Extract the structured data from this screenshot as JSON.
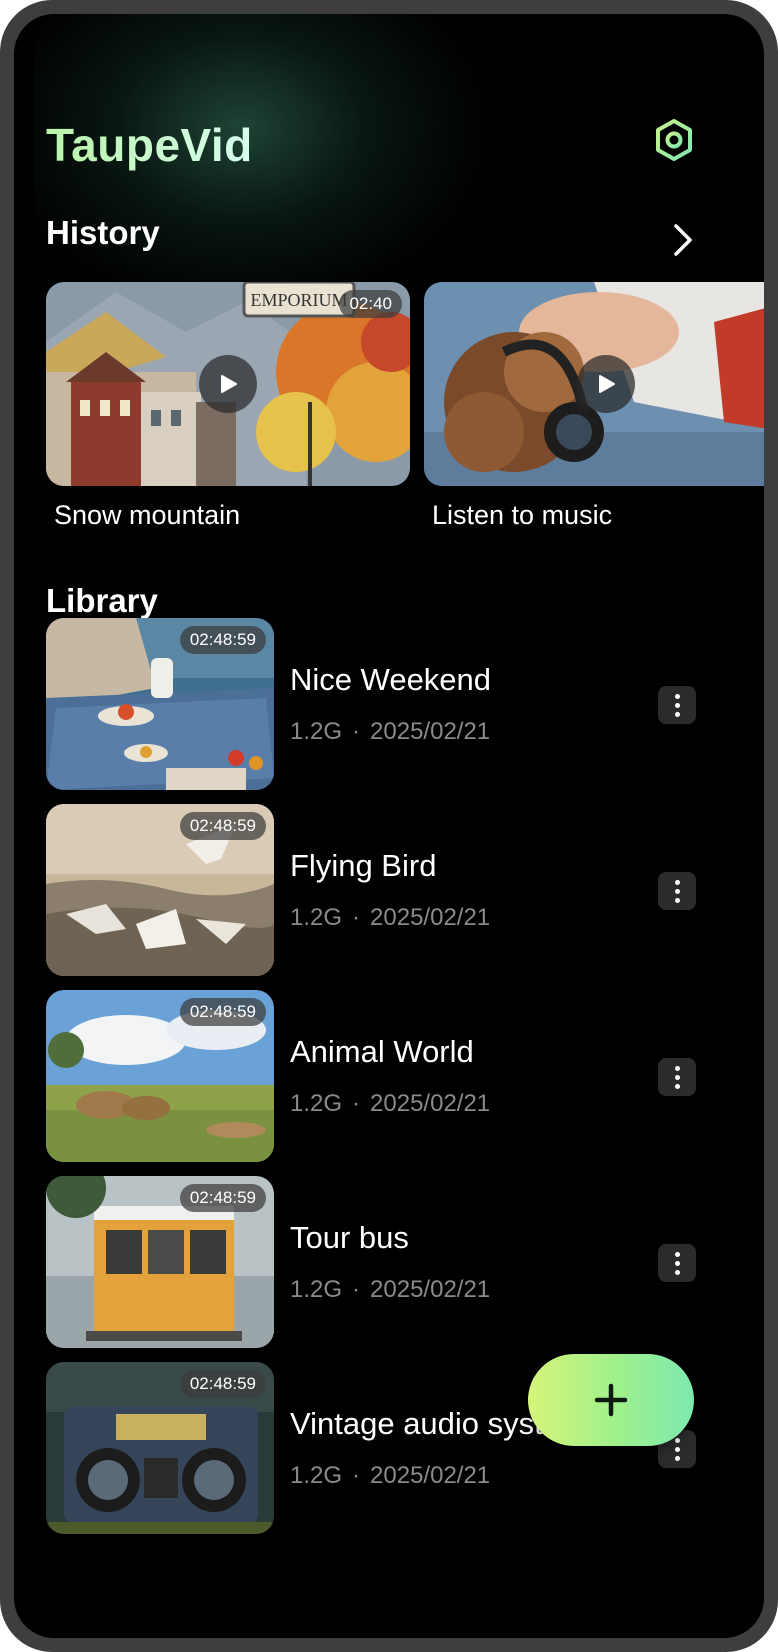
{
  "app": {
    "title": "TaupeVid"
  },
  "icons": {
    "settings": "settings-hex-icon",
    "chevron": "chevron-right-icon",
    "play": "play-icon",
    "more": "more-vertical-icon",
    "add": "plus-icon"
  },
  "colors": {
    "background": "#000000",
    "accent_start": "#d6f57a",
    "accent_end": "#7de8b0",
    "meta_text": "#8a8a8a"
  },
  "history": {
    "title": "History",
    "items": [
      {
        "caption": "Snow mountain",
        "duration": "02:40"
      },
      {
        "caption": "Listen to music"
      }
    ]
  },
  "library": {
    "title": "Library",
    "items": [
      {
        "name": "Nice Weekend",
        "duration": "02:48:59",
        "size": "1.2G",
        "sep": "·",
        "date": "2025/02/21"
      },
      {
        "name": "Flying Bird",
        "duration": "02:48:59",
        "size": "1.2G",
        "sep": "·",
        "date": "2025/02/21"
      },
      {
        "name": "Animal World",
        "duration": "02:48:59",
        "size": "1.2G",
        "sep": "·",
        "date": "2025/02/21"
      },
      {
        "name": "Tour bus",
        "duration": "02:48:59",
        "size": "1.2G",
        "sep": "·",
        "date": "2025/02/21"
      },
      {
        "name": "Vintage audio system",
        "duration": "02:48:59",
        "size": "1.2G",
        "sep": "·",
        "date": "2025/02/21"
      }
    ]
  }
}
